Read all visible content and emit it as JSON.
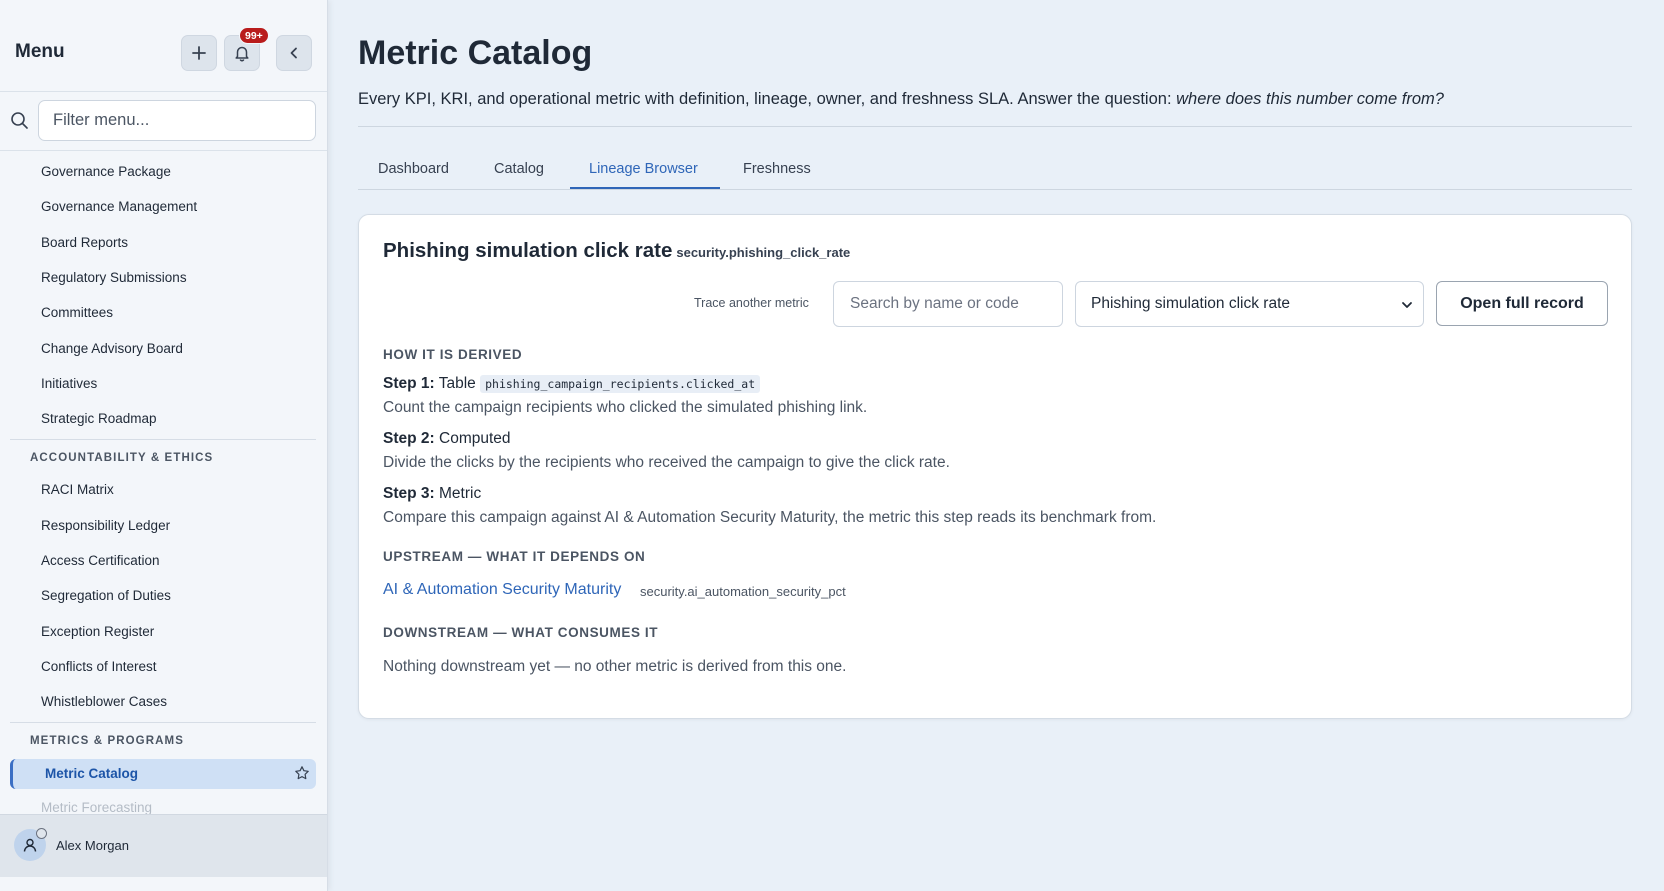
{
  "sidebar": {
    "title": "Menu",
    "notification_badge": "99+",
    "search_placeholder": "Filter menu...",
    "items_top": [
      "Governance Package",
      "Governance Management",
      "Board Reports",
      "Regulatory Submissions",
      "Committees",
      "Change Advisory Board",
      "Initiatives",
      "Strategic Roadmap"
    ],
    "section_accountability": "ACCOUNTABILITY & ETHICS",
    "items_accountability": [
      "RACI Matrix",
      "Responsibility Ledger",
      "Access Certification",
      "Segregation of Duties",
      "Exception Register",
      "Conflicts of Interest",
      "Whistleblower Cases"
    ],
    "section_metrics": "METRICS & PROGRAMS",
    "active_item": "Metric Catalog",
    "faded_item": "Metric Forecasting",
    "user_name": "Alex Morgan"
  },
  "page": {
    "title": "Metric Catalog",
    "subtitle_plain": "Every KPI, KRI, and operational metric with definition, lineage, owner, and freshness SLA. Answer the question: ",
    "subtitle_italic": "where does this number come from?",
    "tabs": [
      "Dashboard",
      "Catalog",
      "Lineage Browser",
      "Freshness"
    ],
    "active_tab": "Lineage Browser"
  },
  "card": {
    "title": "Phishing simulation click rate",
    "code": "security.phishing_click_rate",
    "trace_label": "Trace another metric",
    "trace_search_placeholder": "Search by name or code",
    "trace_select_value": "Phishing simulation click rate",
    "open_button": "Open full record",
    "derived_heading": "HOW IT IS DERIVED",
    "steps": [
      {
        "label": "Step 1:",
        "kind": "Table",
        "code": "phishing_campaign_recipients.clicked_at",
        "desc": "Count the campaign recipients who clicked the simulated phishing link."
      },
      {
        "label": "Step 2:",
        "kind": "Computed",
        "code": "",
        "desc": "Divide the clicks by the recipients who received the campaign to give the click rate."
      },
      {
        "label": "Step 3:",
        "kind": "Metric",
        "code": "",
        "desc": "Compare this campaign against AI & Automation Security Maturity, the metric this step reads its benchmark from."
      }
    ],
    "upstream_heading": "UPSTREAM — WHAT IT DEPENDS ON",
    "upstream_link": "AI & Automation Security Maturity",
    "upstream_code": "security.ai_automation_security_pct",
    "downstream_heading": "DOWNSTREAM — WHAT CONSUMES IT",
    "downstream_text": "Nothing downstream yet — no other metric is derived from this one."
  },
  "colors": {
    "accent": "#2f66b8",
    "badge": "#b91c1c",
    "active_bg": "#cfe0f5"
  }
}
